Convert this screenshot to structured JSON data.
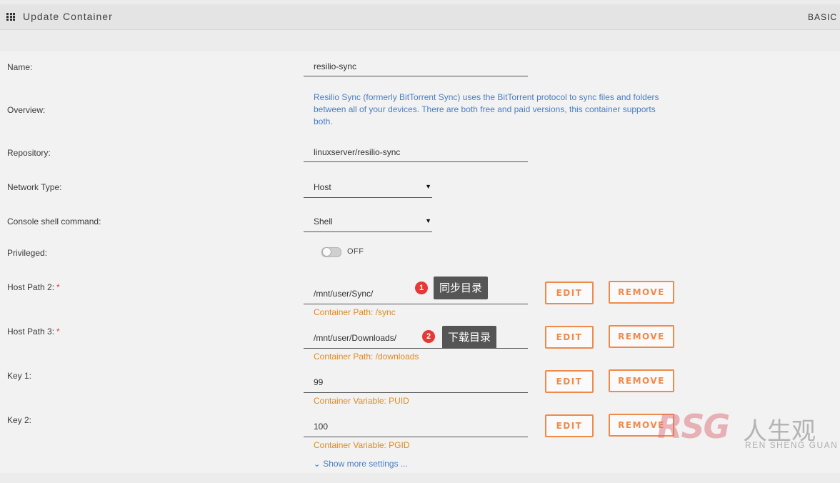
{
  "header": {
    "title": "Update Container",
    "mode": "BASIC"
  },
  "fields": {
    "name": {
      "label": "Name:",
      "value": "resilio-sync"
    },
    "overview": {
      "label": "Overview:",
      "text": "Resilio Sync (formerly BitTorrent Sync) uses the BitTorrent protocol to sync files and folders between all of your devices. There are both free and paid versions, this container supports both."
    },
    "repository": {
      "label": "Repository:",
      "value": "linuxserver/resilio-sync"
    },
    "network_type": {
      "label": "Network Type:",
      "value": "Host"
    },
    "console": {
      "label": "Console shell command:",
      "value": "Shell"
    },
    "privileged": {
      "label": "Privileged:",
      "state": "OFF"
    }
  },
  "mappings": [
    {
      "label": "Host Path 2:",
      "required": "*",
      "value": "/mnt/user/Sync/",
      "sub": "Container Path: /sync",
      "badge": "1",
      "tip": "同步目录"
    },
    {
      "label": "Host Path 3:",
      "required": "*",
      "value": "/mnt/user/Downloads/",
      "sub": "Container Path: /downloads",
      "badge": "2",
      "tip": "下载目录"
    },
    {
      "label": "Key 1:",
      "value": "99",
      "sub": "Container Variable: PUID"
    },
    {
      "label": "Key 2:",
      "value": "100",
      "sub": "Container Variable: PGID"
    }
  ],
  "buttons": {
    "edit": "EDIT",
    "remove": "REMOVE"
  },
  "more": "Show more settings ...",
  "watermark": {
    "logo": "RSG",
    "cn": "人生观",
    "en": "REN SHENG GUAN"
  },
  "colors": {
    "accent": "#f08a4b",
    "link": "#4a7ec2",
    "sub": "#e08a1e",
    "badge": "#e53935"
  }
}
